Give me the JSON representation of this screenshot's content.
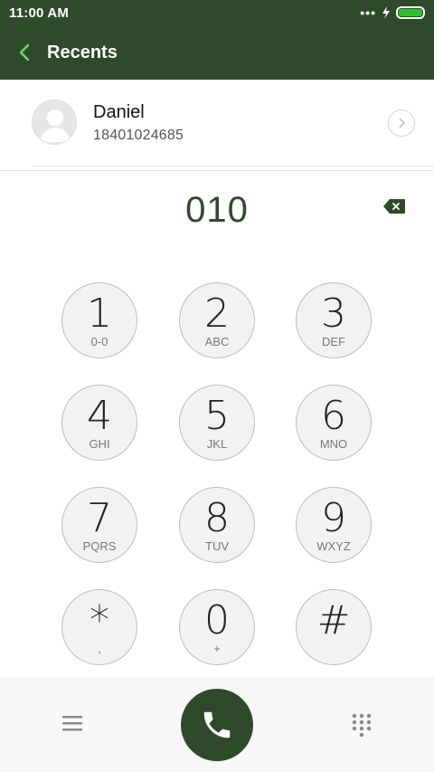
{
  "status": {
    "time": "11:00 AM",
    "dots": "•••"
  },
  "appbar": {
    "title": "Recents"
  },
  "contact": {
    "name": "Daniel",
    "number": "18401024685"
  },
  "dialer": {
    "entered": "010"
  },
  "keys": [
    {
      "num": "1",
      "sub": "0-0"
    },
    {
      "num": "2",
      "sub": "ABC"
    },
    {
      "num": "3",
      "sub": "DEF"
    },
    {
      "num": "4",
      "sub": "GHI"
    },
    {
      "num": "5",
      "sub": "JKL"
    },
    {
      "num": "6",
      "sub": "MNO"
    },
    {
      "num": "7",
      "sub": "PQRS"
    },
    {
      "num": "8",
      "sub": "TUV"
    },
    {
      "num": "9",
      "sub": "WXYZ"
    },
    {
      "num": "*",
      "sub": ","
    },
    {
      "num": "0",
      "sub": "+"
    },
    {
      "num": "#",
      "sub": ""
    }
  ],
  "colors": {
    "primary": "#2e4a2a",
    "battery": "#29c329"
  },
  "icons": {
    "back": "back-arrow-icon",
    "backspace": "backspace-icon",
    "menu": "menu-icon",
    "call": "phone-icon",
    "keypad": "keypad-icon"
  }
}
